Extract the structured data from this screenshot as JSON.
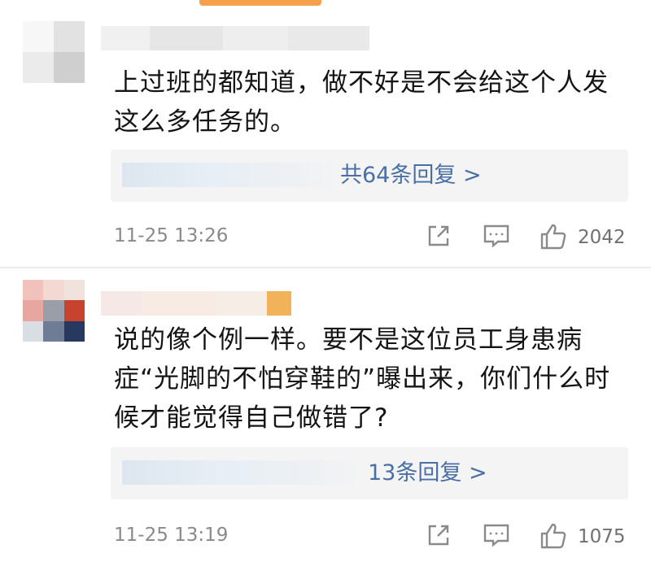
{
  "comments": [
    {
      "text_line1": "上过班的都知道，做不好是不会给这个人发",
      "text_line2": "这么多任务的。",
      "replies_label": "共64条回复 >",
      "timestamp": "11-25 13:26",
      "likes": "2042"
    },
    {
      "text_line1": "说的像个例一样。要不是这位员工身患病",
      "text_line2": "症“光脚的不怕穿鞋的”曝出来，你们什么时",
      "text_line3": "候才能觉得自己做错了?",
      "replies_label": "13条回复 >",
      "timestamp": "11-25 13:19",
      "likes": "1075"
    }
  ],
  "icons": {
    "share": "share-icon",
    "comment": "comment-icon",
    "like": "thumbs-up-icon"
  },
  "colors": {
    "reply_link": "#4a6fa5",
    "meta_text": "#8a8a8a",
    "accent_bar": "#f5a04a"
  }
}
